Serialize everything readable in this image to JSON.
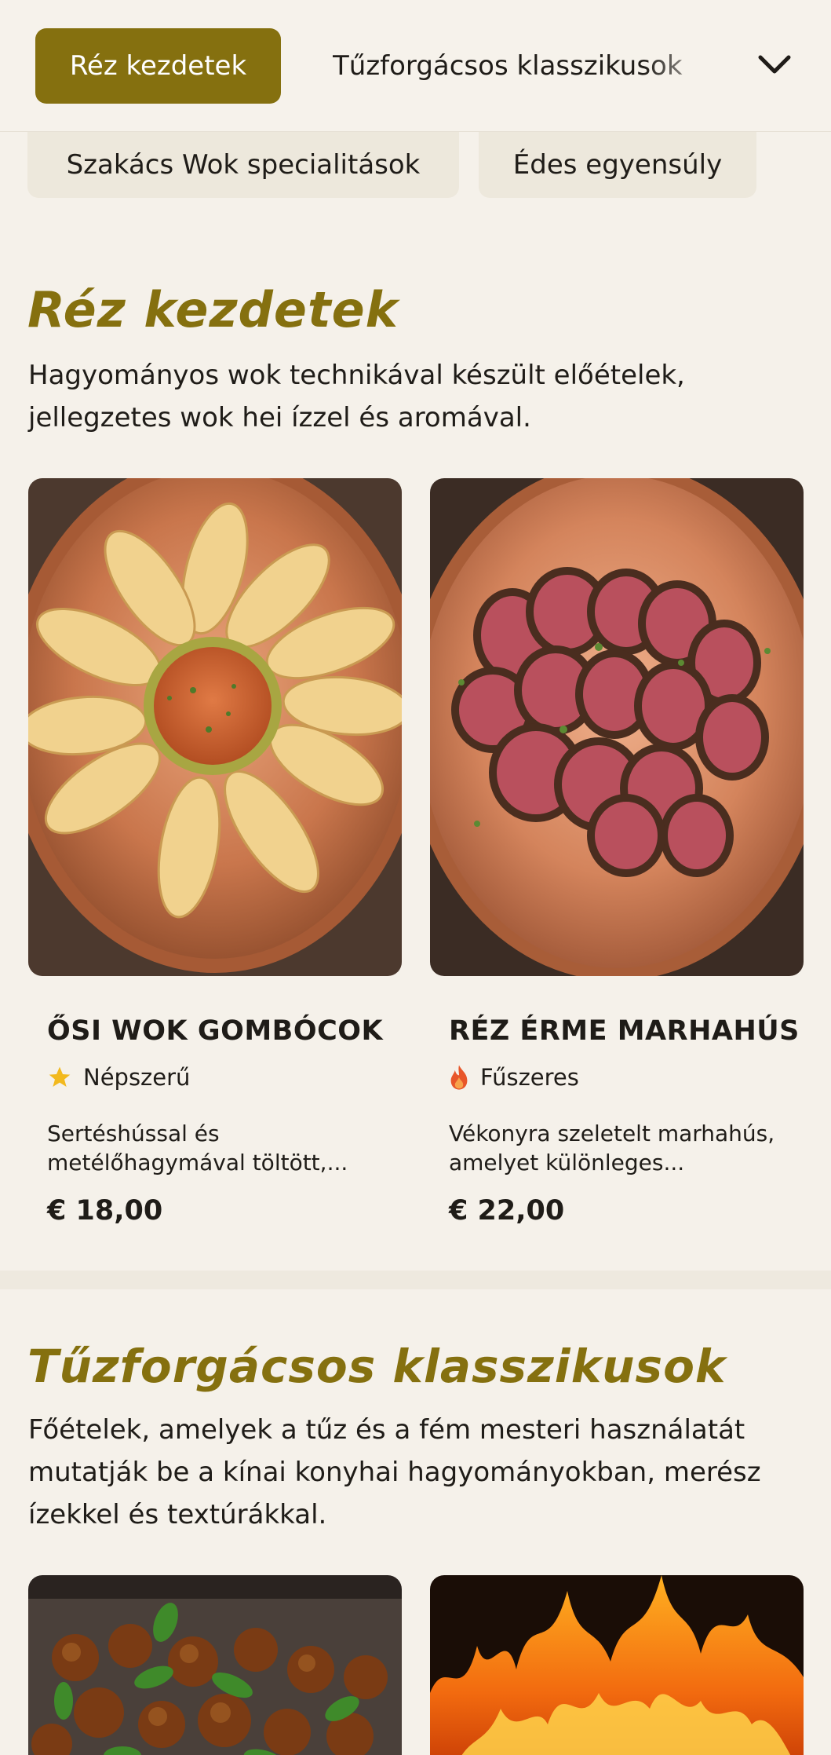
{
  "nav": {
    "active_category": "Réz kezdetek",
    "second_category": "Tűzforgácsos klasszikusok",
    "row2": [
      "Szakács Wok specialitások",
      "Édes egyensúly"
    ]
  },
  "sections": [
    {
      "title": "Réz kezdetek",
      "description": "Hagyományos wok technikával készült előételek, jellegzetes wok hei ízzel és aromával."
    },
    {
      "title": "Tűzforgácsos klasszikusok",
      "description": "Főételek, amelyek a tűz és a fém mesteri használatát mutatják be a kínai konyhai hagyományokban, merész ízekkel és textúrákkal."
    }
  ],
  "dishes": [
    {
      "name": "ŐSI WOK GOMBÓCOK",
      "tag": "Népszerű",
      "tag_icon": "star-icon",
      "description": "Sertéshússal és metélőhagymával töltött,...",
      "price": "€ 18,00"
    },
    {
      "name": "RÉZ ÉRME MARHAHÚS",
      "tag": "Fűszeres",
      "tag_icon": "flame-icon",
      "description": "Vékonyra szeletelt marhahús, amelyet különleges...",
      "price": "€ 22,00"
    }
  ],
  "colors": {
    "accent": "#85700f",
    "background": "#f5f1ea",
    "star": "#f2b91e",
    "flame": "#e8562a"
  }
}
